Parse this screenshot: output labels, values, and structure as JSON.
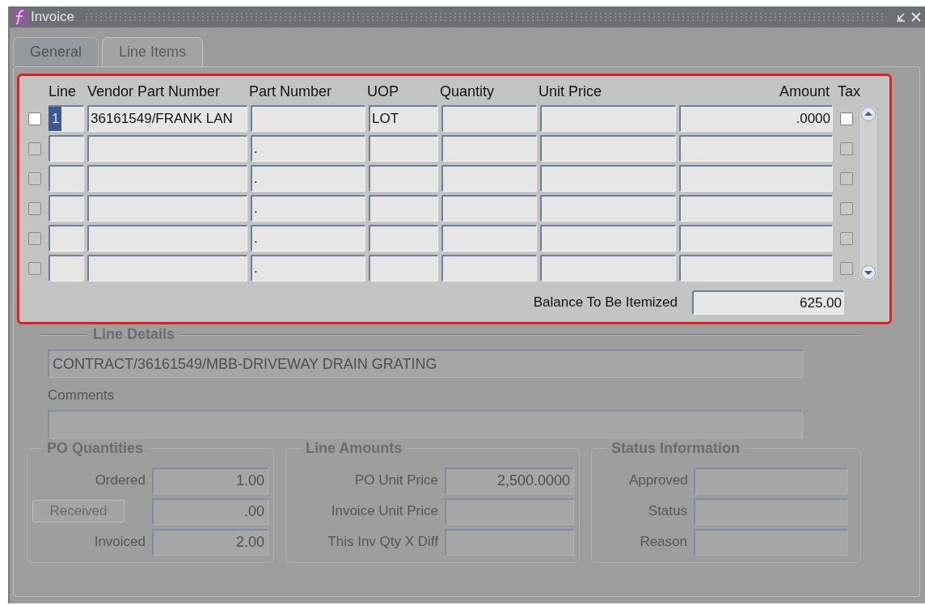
{
  "window": {
    "title": "Invoice"
  },
  "tabs": [
    {
      "label": "General",
      "selected": false
    },
    {
      "label": "Line Items",
      "selected": true
    }
  ],
  "line_items": {
    "columns": [
      "Line",
      "Vendor Part Number",
      "Part Number",
      "UOP",
      "Quantity",
      "Unit Price",
      "Amount",
      "Tax"
    ],
    "rows": [
      {
        "selected": false,
        "disabled": false,
        "line": "1",
        "line_focused": true,
        "vendor_part_number": "36161549/FRANK LAN",
        "part_number": "",
        "uop": "LOT",
        "quantity": "",
        "unit_price": "",
        "amount": ".0000",
        "tax": false
      },
      {
        "selected": false,
        "disabled": true,
        "line": "",
        "line_focused": false,
        "vendor_part_number": "",
        "part_number": ".",
        "uop": "",
        "quantity": "",
        "unit_price": "",
        "amount": "",
        "tax": false
      },
      {
        "selected": false,
        "disabled": true,
        "line": "",
        "line_focused": false,
        "vendor_part_number": "",
        "part_number": ".",
        "uop": "",
        "quantity": "",
        "unit_price": "",
        "amount": "",
        "tax": false
      },
      {
        "selected": false,
        "disabled": true,
        "line": "",
        "line_focused": false,
        "vendor_part_number": "",
        "part_number": ".",
        "uop": "",
        "quantity": "",
        "unit_price": "",
        "amount": "",
        "tax": false
      },
      {
        "selected": false,
        "disabled": true,
        "line": "",
        "line_focused": false,
        "vendor_part_number": "",
        "part_number": ".",
        "uop": "",
        "quantity": "",
        "unit_price": "",
        "amount": "",
        "tax": false
      },
      {
        "selected": false,
        "disabled": true,
        "line": "",
        "line_focused": false,
        "vendor_part_number": "",
        "part_number": ".",
        "uop": "",
        "quantity": "",
        "unit_price": "",
        "amount": "",
        "tax": false
      }
    ],
    "balance": {
      "label": "Balance To Be Itemized",
      "value": "625.00"
    }
  },
  "line_details": {
    "title": "Line Details",
    "description": "CONTRACT/36161549/MBB-DRIVEWAY DRAIN GRATING",
    "comments_label": "Comments"
  },
  "groups": [
    {
      "title": "PO Quantities",
      "fields": [
        {
          "kind": "label",
          "label": "Ordered",
          "value": "1.00"
        },
        {
          "kind": "button",
          "label": "Received",
          "value": ".00"
        },
        {
          "kind": "label",
          "label": "Invoiced",
          "value": "2.00"
        }
      ]
    },
    {
      "title": "Line Amounts",
      "fields": [
        {
          "kind": "label",
          "label": "PO Unit Price",
          "value": "2,500.0000"
        },
        {
          "kind": "label",
          "label": "Invoice Unit Price"
        },
        {
          "kind": "label",
          "label": "This Inv Qty X Diff"
        }
      ]
    },
    {
      "title": "Status Information",
      "fields": [
        {
          "kind": "label",
          "label": "Approved"
        },
        {
          "kind": "label",
          "label": "Status"
        },
        {
          "kind": "label",
          "label": "Reason"
        }
      ]
    }
  ]
}
